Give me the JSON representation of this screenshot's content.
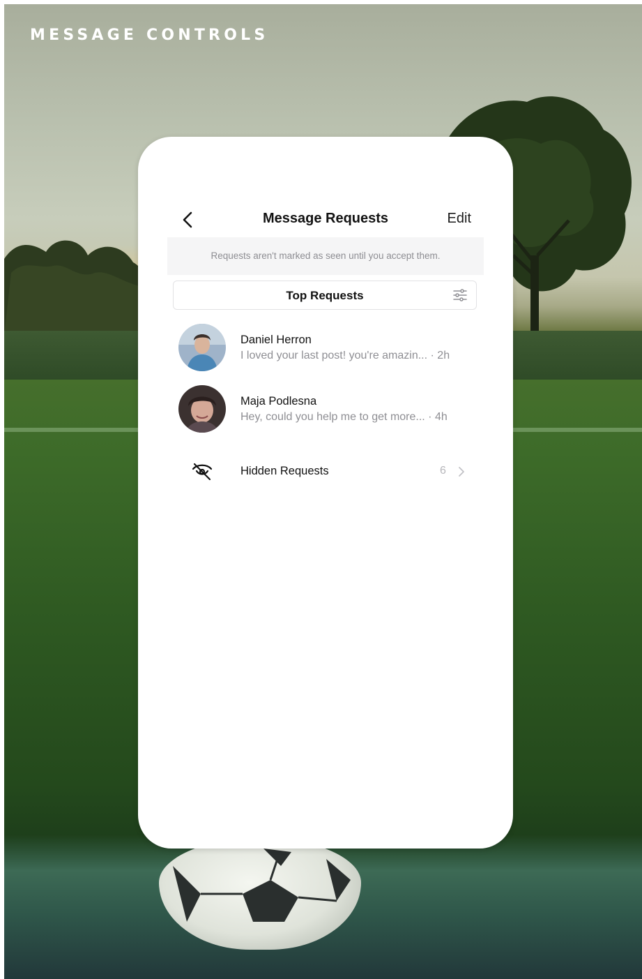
{
  "header": {
    "label": "MESSAGE CONTROLS"
  },
  "screen": {
    "title": "Message Requests",
    "edit_label": "Edit",
    "notice": "Requests aren't marked as seen until you accept them.",
    "filter": {
      "label": "Top Requests"
    },
    "requests": [
      {
        "name": "Daniel Herron",
        "preview": "I loved your last post! you're amazin... · 2h"
      },
      {
        "name": "Maja Podlesna",
        "preview": "Hey, could you help me to get more... · 4h"
      }
    ],
    "hidden": {
      "label": "Hidden Requests",
      "count": "6"
    }
  },
  "icons": {
    "back": "chevron-left-icon",
    "filter": "sliders-icon",
    "hidden": "eye-off-icon",
    "more": "chevron-right-icon"
  },
  "colors": {
    "text_primary": "#121212",
    "text_secondary": "#8e8e93",
    "notice_bg": "#f5f5f6",
    "card_bg": "#ffffff"
  }
}
